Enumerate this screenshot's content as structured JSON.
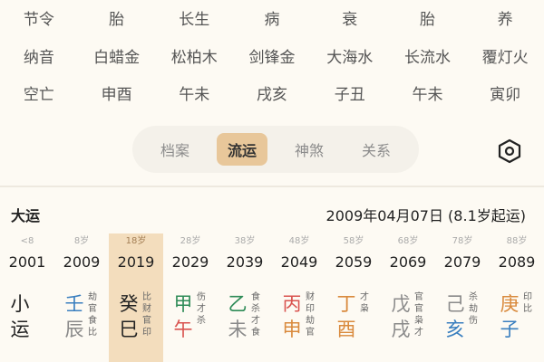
{
  "rows": [
    [
      "节令",
      "胎",
      "长生",
      "病",
      "衰",
      "胎",
      "养"
    ],
    [
      "纳音",
      "白蜡金",
      "松柏木",
      "剑锋金",
      "大海水",
      "长流水",
      "覆灯火"
    ],
    [
      "空亡",
      "申酉",
      "午未",
      "戌亥",
      "子丑",
      "午未",
      "寅卯"
    ]
  ],
  "tabs": [
    "档案",
    "流运",
    "神煞",
    "关系"
  ],
  "active_tab": 1,
  "dayun": {
    "label": "大运",
    "date": "2009年04月07日 (8.1岁起运)"
  },
  "columns": [
    {
      "age": "<8",
      "year": "2001",
      "gan": "小",
      "zhi": "运",
      "gan_color": "#222",
      "zhi_color": "#222",
      "gods": [
        "",
        ""
      ],
      "sub": []
    },
    {
      "age": "8岁",
      "year": "2009",
      "gan": "壬",
      "zhi": "辰",
      "gan_color": "#3a7fbf",
      "zhi_color": "#8a8a8a",
      "gods": [
        "劫"
      ],
      "sub": [
        "官",
        "食",
        "比"
      ]
    },
    {
      "age": "18岁",
      "year": "2019",
      "gan": "癸",
      "zhi": "巳",
      "gan_color": "#222",
      "zhi_color": "#222",
      "gods": [
        "比"
      ],
      "sub": [
        "财",
        "官",
        "印"
      ]
    },
    {
      "age": "28岁",
      "year": "2029",
      "gan": "甲",
      "zhi": "午",
      "gan_color": "#2e8b57",
      "zhi_color": "#d9534f",
      "gods": [
        "伤"
      ],
      "sub": [
        "才",
        "杀"
      ]
    },
    {
      "age": "38岁",
      "year": "2039",
      "gan": "乙",
      "zhi": "未",
      "gan_color": "#2e8b57",
      "zhi_color": "#8a8a8a",
      "gods": [
        "食"
      ],
      "sub": [
        "杀",
        "才",
        "食"
      ]
    },
    {
      "age": "48岁",
      "year": "2049",
      "gan": "丙",
      "zhi": "申",
      "gan_color": "#d9534f",
      "zhi_color": "#d98a3d",
      "gods": [
        "财"
      ],
      "sub": [
        "印",
        "劫",
        "官"
      ]
    },
    {
      "age": "58岁",
      "year": "2059",
      "gan": "丁",
      "zhi": "酉",
      "gan_color": "#d98a3d",
      "zhi_color": "#d98a3d",
      "gods": [
        "才"
      ],
      "sub": [
        "枭"
      ]
    },
    {
      "age": "68岁",
      "year": "2069",
      "gan": "戊",
      "zhi": "戌",
      "gan_color": "#8a8a8a",
      "zhi_color": "#8a8a8a",
      "gods": [
        "官"
      ],
      "sub": [
        "官",
        "枭",
        "才"
      ]
    },
    {
      "age": "78岁",
      "year": "2079",
      "gan": "己",
      "zhi": "亥",
      "gan_color": "#8a8a8a",
      "zhi_color": "#3a7fbf",
      "gods": [
        "杀"
      ],
      "sub": [
        "劫",
        "伤"
      ]
    },
    {
      "age": "88岁",
      "year": "2089",
      "gan": "庚",
      "zhi": "子",
      "gan_color": "#d98a3d",
      "zhi_color": "#3a7fbf",
      "gods": [
        "印"
      ],
      "sub": [
        "比"
      ]
    }
  ],
  "icons": {
    "settings": "hexagon-gear-icon"
  }
}
